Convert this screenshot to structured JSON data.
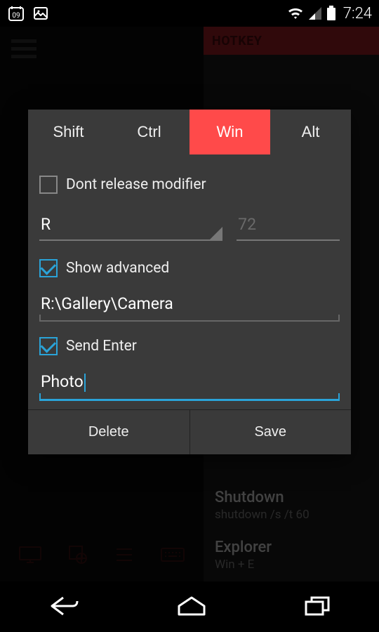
{
  "statusbar": {
    "calendar_day": "09",
    "time": "7:24"
  },
  "background": {
    "panel_title": "HOTKEY",
    "list": [
      {
        "title": "Shutdown",
        "subtitle": "shutdown /s /t 60"
      },
      {
        "title": "Explorer",
        "subtitle": "Win + E"
      }
    ]
  },
  "dialog": {
    "tabs": [
      "Shift",
      "Ctrl",
      "Win",
      "Alt"
    ],
    "active_tab_index": 2,
    "dont_release_label": "Dont release modifier",
    "dont_release_checked": false,
    "key_value": "R",
    "keycode_value": "72",
    "show_advanced_label": "Show advanced",
    "show_advanced_checked": true,
    "path_value": "R:\\Gallery\\Camera",
    "send_enter_label": "Send Enter",
    "send_enter_checked": true,
    "name_value": "Photo",
    "delete_label": "Delete",
    "save_label": "Save"
  },
  "colors": {
    "accent_red": "#ff4a4a",
    "accent_cyan": "#2aa3d8",
    "dialog_bg": "#3a3a3a"
  }
}
